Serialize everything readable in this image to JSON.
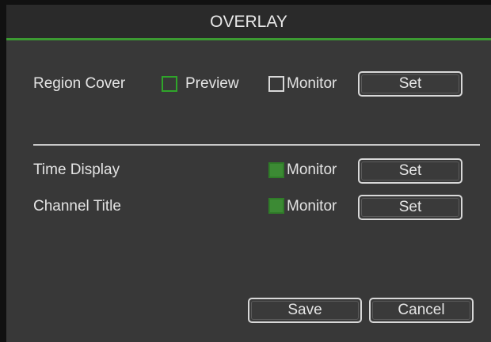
{
  "window": {
    "title": "OVERLAY"
  },
  "region_cover": {
    "label": "Region Cover",
    "preview_label": "Preview",
    "monitor_label": "Monitor",
    "set_label": "Set"
  },
  "time_display": {
    "label": "Time Display",
    "monitor_label": "Monitor",
    "set_label": "Set"
  },
  "channel_title": {
    "label": "Channel Title",
    "monitor_label": "Monitor",
    "set_label": "Set"
  },
  "footer": {
    "save_label": "Save",
    "cancel_label": "Cancel"
  },
  "colors": {
    "accent": "#3c9a32",
    "background": "#383838",
    "titlebar": "#2a2a2a"
  }
}
